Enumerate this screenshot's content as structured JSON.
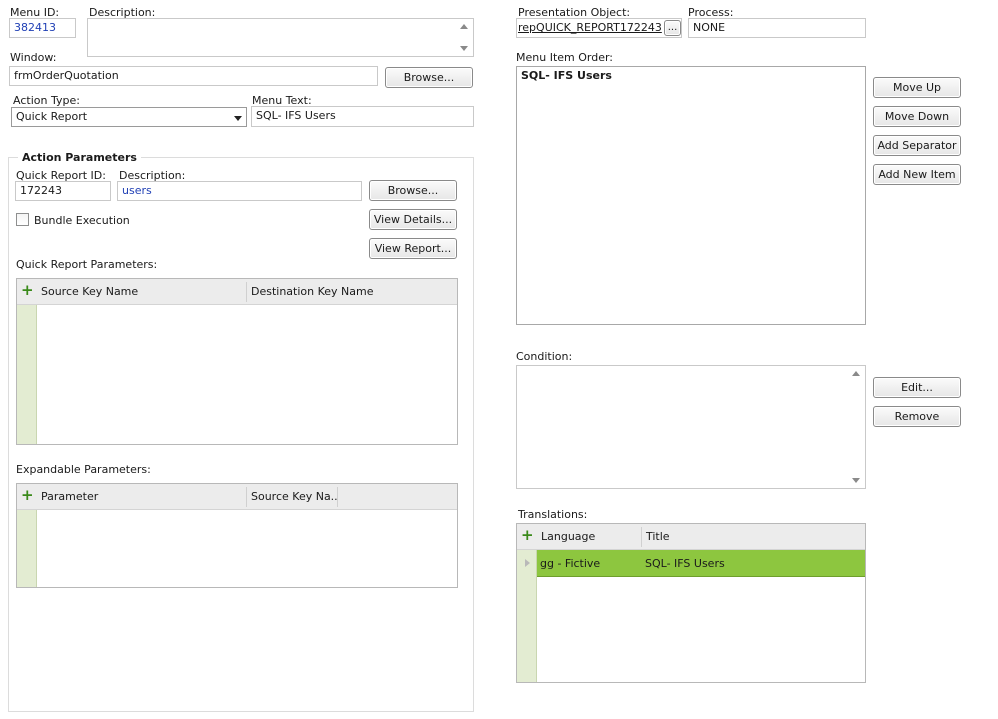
{
  "menu_id": {
    "label": "Menu ID:",
    "value": "382413"
  },
  "description": {
    "label": "Description:",
    "value": ""
  },
  "window": {
    "label": "Window:",
    "value": "frmOrderQuotation",
    "browse": "Browse..."
  },
  "action_type": {
    "label": "Action Type:",
    "value": "Quick Report"
  },
  "menu_text": {
    "label": "Menu Text:",
    "value": "SQL- IFS Users"
  },
  "action_params": {
    "title": "Action Parameters",
    "qr_id_label": "Quick Report ID:",
    "qr_id_value": "172243",
    "desc_label": "Description:",
    "desc_value": "users",
    "browse": "Browse...",
    "bundle_label": "Bundle Execution",
    "view_details": "View Details...",
    "view_report": "View Report...",
    "qr_params_label": "Quick Report Parameters:",
    "qr_params_columns": [
      "Source Key Name",
      "Destination Key Name"
    ],
    "exp_params_label": "Expandable Parameters:",
    "exp_params_columns": [
      "Parameter",
      "Source Key Na..."
    ]
  },
  "presentation_object": {
    "label": "Presentation Object:",
    "value": "repQUICK_REPORT172243",
    "ellipsis": "..."
  },
  "process": {
    "label": "Process:",
    "value": "NONE"
  },
  "menu_item_order": {
    "label": "Menu Item Order:",
    "items": [
      "SQL- IFS Users"
    ]
  },
  "order_buttons": {
    "move_up": "Move Up",
    "move_down": "Move Down",
    "add_separator": "Add Separator",
    "add_new_item": "Add New Item"
  },
  "condition": {
    "label": "Condition:",
    "edit": "Edit...",
    "remove": "Remove"
  },
  "translations": {
    "label": "Translations:",
    "columns": [
      "Language",
      "Title"
    ],
    "rows": [
      {
        "language": "gg - Fictive",
        "title": "SQL- IFS Users"
      }
    ],
    "selected_color": "#8dc63f"
  }
}
